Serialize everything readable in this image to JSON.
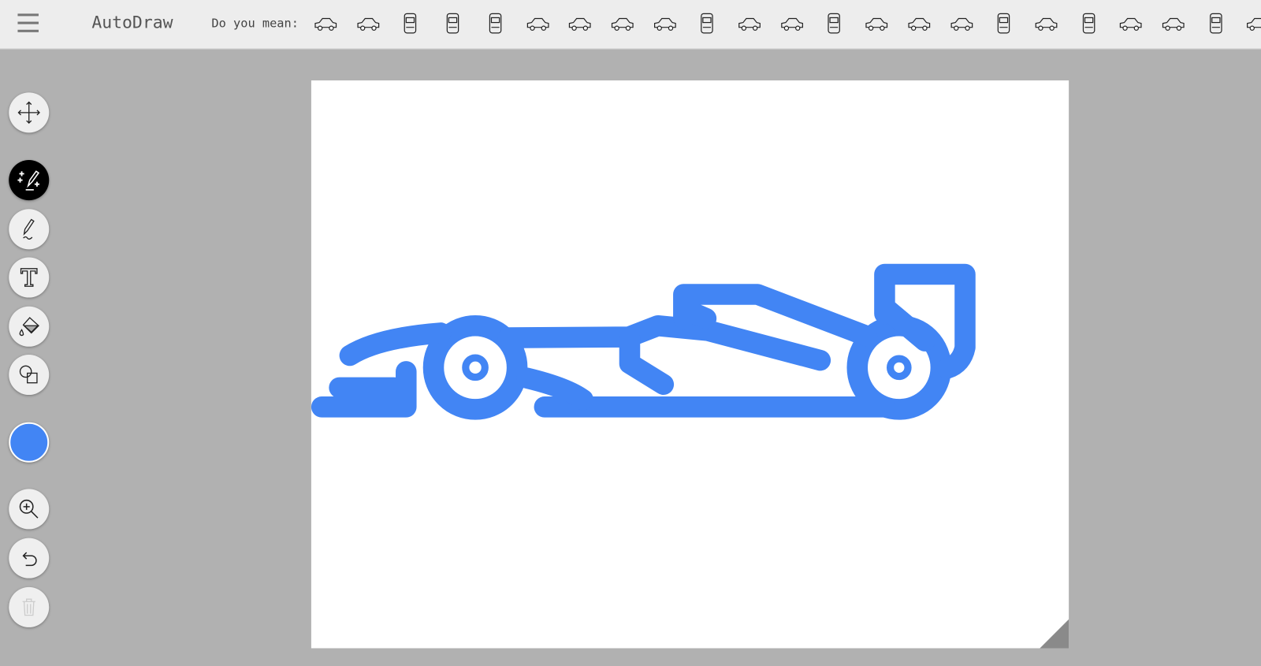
{
  "app": {
    "title": "AutoDraw"
  },
  "suggestions": {
    "label": "Do you mean:",
    "items": [
      "police-car",
      "taxi",
      "car-top-view",
      "race-car-top-view",
      "race-car-front",
      "race-car-side",
      "car-outline",
      "sedan-outline",
      "car",
      "car-front",
      "coupe",
      "fire-truck",
      "fire-truck-front",
      "ladder-truck",
      "cargo-truck",
      "semi-tractor",
      "semi-truck-front",
      "pickup-truck",
      "suv-front",
      "jeep",
      "minivan",
      "bus-front",
      "van"
    ]
  },
  "toolbar": {
    "tools": [
      "move",
      "autodraw",
      "draw",
      "type",
      "fill",
      "shape",
      "color",
      "zoom",
      "undo",
      "delete"
    ],
    "active_tool": "autodraw",
    "selected_color": "#4285F4"
  },
  "drawing": {
    "stroke_color": "#4285F4"
  }
}
